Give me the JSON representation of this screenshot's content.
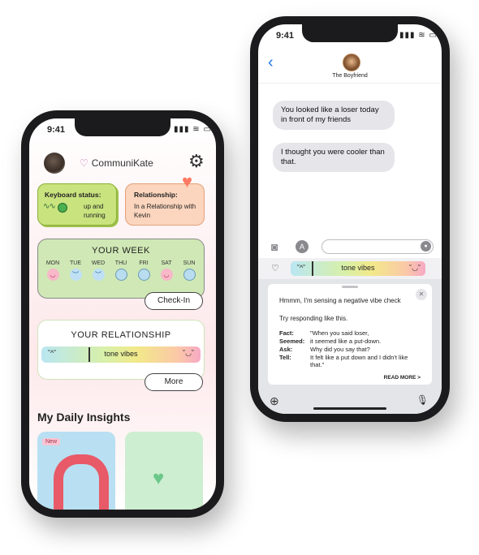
{
  "left_phone": {
    "time": "9:41",
    "status_icons": "▮▮▮ ≋ ▭",
    "brand": "CommuniKate",
    "brand_logo": "♡",
    "gear_icon": "⚙",
    "keyboard_card": {
      "title": "Keyboard status:",
      "status": "up and running"
    },
    "relationship_card": {
      "title": "Relationship:",
      "status": "In a Relationship with Kevin"
    },
    "heart_icon": "♥",
    "your_week": {
      "title": "YOUR WEEK",
      "days": [
        {
          "label": "MON",
          "mood": "happy",
          "glyph": "◡"
        },
        {
          "label": "TUE",
          "mood": "sad",
          "glyph": "︶"
        },
        {
          "label": "WED",
          "mood": "sad",
          "glyph": "︶"
        },
        {
          "label": "THU",
          "mood": "none",
          "glyph": ""
        },
        {
          "label": "FRI",
          "mood": "none",
          "glyph": ""
        },
        {
          "label": "SAT",
          "mood": "happy",
          "glyph": "◡"
        },
        {
          "label": "SUN",
          "mood": "none",
          "glyph": ""
        }
      ],
      "checkin_label": "Check-In"
    },
    "your_relationship": {
      "title": "YOUR RELATIONSHIP",
      "tone_label": "tone vibes",
      "face_left": "˘^˘",
      "face_right": "˘◡˘",
      "more_label": "More"
    },
    "insights_title": "My Daily Insights",
    "insight_badge": "New"
  },
  "right_phone": {
    "time": "9:41",
    "status_icons": "▮▮▮ ≋ ▭",
    "back_icon": "‹",
    "contact_name": "The Boyfriend",
    "messages": [
      "You looked like a loser today in front of my friends",
      "I thought you were cooler than that."
    ],
    "camera_icon": "◙",
    "apps_icon": "A",
    "mic_icon": "●",
    "tone_logo": "♡",
    "tone_label": "tone vibes",
    "tone_face_left": "˘^˘",
    "tone_face_right": "˘◡˘",
    "sheet": {
      "close_icon": "✕",
      "heading": "Hmmm, I'm sensing a negative vibe check",
      "subheading": "Try responding like this.",
      "rows": [
        {
          "key": "Fact:",
          "value": "\"When you said loser,"
        },
        {
          "key": "Seemed:",
          "value": "it seemed like a put-down."
        },
        {
          "key": "Ask:",
          "value": "Why did you say that?"
        },
        {
          "key": "Tell:",
          "value": "It felt like a put down and I didn't like that.\""
        }
      ],
      "read_more": "READ MORE >"
    },
    "globe_icon": "⊕",
    "mic_kb_icon": "🎙"
  }
}
